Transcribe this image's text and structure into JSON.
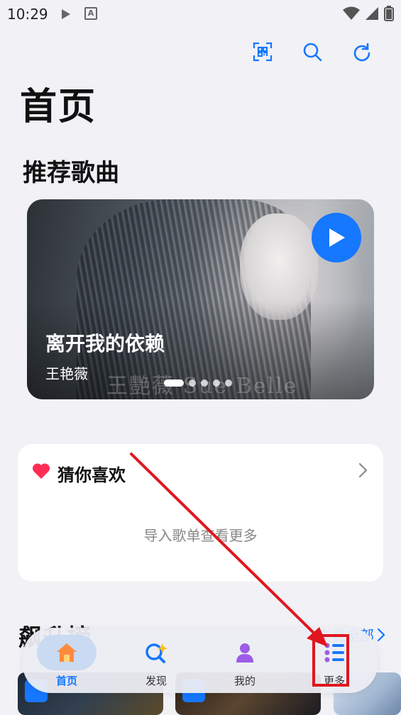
{
  "status_bar": {
    "time": "10:29"
  },
  "header": {
    "title": "首页"
  },
  "recommend": {
    "section_title": "推荐歌曲",
    "song_title": "离开我的依赖",
    "artist": "王艳薇",
    "watermark": "王艷薇 Sue Belle",
    "slide_count": 5,
    "active_slide": 1
  },
  "guess": {
    "title": "猜你喜欢",
    "empty_text": "导入歌单查看更多"
  },
  "section2": {
    "title": "飙升榜",
    "more_label": "查看全部"
  },
  "bottom_nav": {
    "items": [
      {
        "label": "首页",
        "icon": "home-icon",
        "active": true
      },
      {
        "label": "发现",
        "icon": "discover-icon",
        "active": false
      },
      {
        "label": "我的",
        "icon": "profile-icon",
        "active": false
      },
      {
        "label": "更多",
        "icon": "more-list-icon",
        "active": false
      }
    ]
  },
  "colors": {
    "accent": "#1677ff",
    "background": "#f1f1f6",
    "heart": "#ff2d55",
    "annotation": "#e0161f"
  }
}
